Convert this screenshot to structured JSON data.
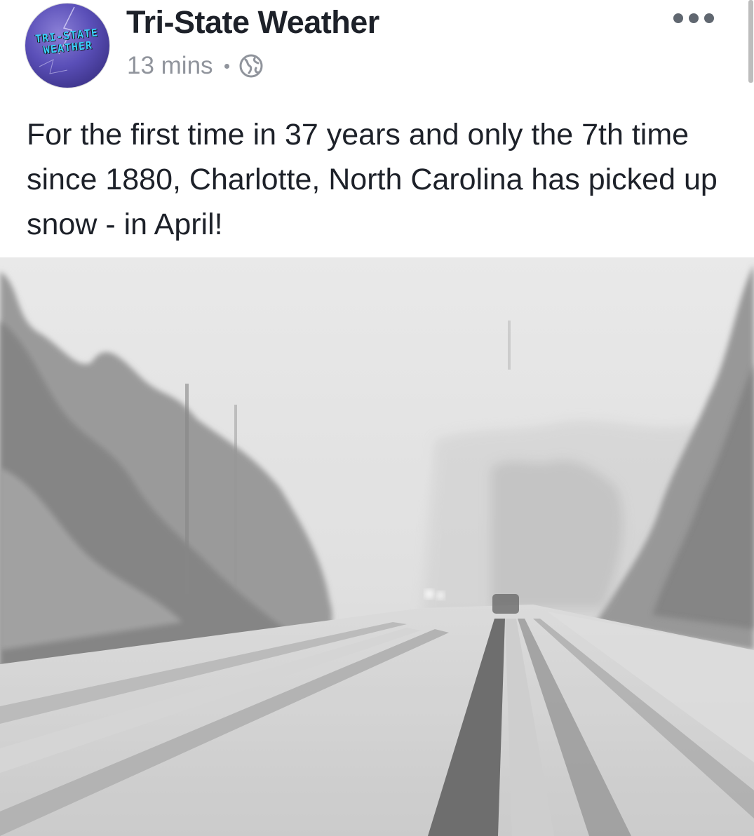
{
  "post": {
    "page_name": "Tri-State Weather",
    "timestamp": "13 mins",
    "audience_icon": "globe-icon",
    "more_icon": "more-horizontal-icon",
    "avatar": {
      "logo_text": "TRI-STATE\nWEATHER"
    },
    "message": "For the first time in 37 years and only the 7th time since 1880, Charlotte, North Carolina has picked up snow - in April!",
    "image": {
      "content": "snowy-road-photo"
    }
  },
  "colors": {
    "text_primary": "#1d2129",
    "text_secondary": "#90949c",
    "avatar_purple": "#5a4fb8"
  }
}
